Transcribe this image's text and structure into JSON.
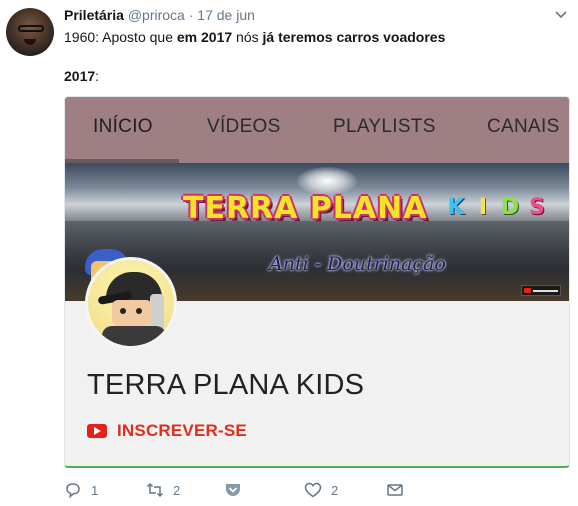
{
  "tweet": {
    "author_name": "Priletária",
    "author_handle": "@priroca",
    "date": "17 de jun",
    "separator": "·",
    "text_parts": {
      "p1": "1960: Aposto que ",
      "p2": "em 2017",
      "p3": " nós ",
      "p4": "já teremos carros voadores"
    },
    "year_label": "2017",
    "year_colon": ":"
  },
  "card": {
    "tabs": [
      {
        "label": "INÍCIO",
        "active": true
      },
      {
        "label": "VÍDEOS"
      },
      {
        "label": "PLAYLISTS"
      },
      {
        "label": "CANAIS"
      }
    ],
    "banner": {
      "title": "TERRA PLANA",
      "kids_letters": [
        "K",
        "I",
        "D",
        "S"
      ],
      "subtitle": "Anti - Doutrinação"
    },
    "channel_name": "TERRA PLANA KIDS",
    "subscribe_label": "INSCREVER-SE"
  },
  "actions": {
    "reply_count": "1",
    "retweet_count": "2",
    "like_count": "2"
  },
  "colors": {
    "tab_bar": "#9d7f84",
    "subscribe": "#e02d1f",
    "youtube_red": "#e62117",
    "muted": "#657786"
  }
}
